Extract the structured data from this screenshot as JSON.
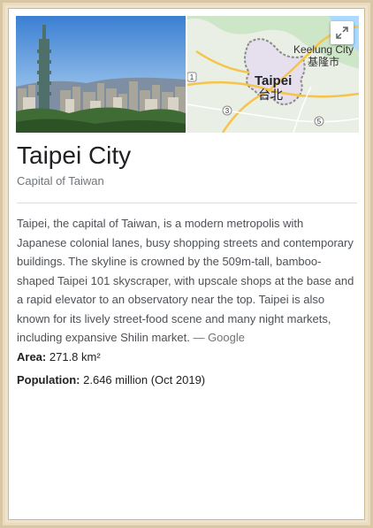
{
  "entity": {
    "title": "Taipei City",
    "subtitle": "Capital of Taiwan"
  },
  "map": {
    "labels": {
      "keelung_en": "Keelung City",
      "keelung_zh": "基隆市",
      "taipei_en": "Taipei",
      "taipei_zh": "台北",
      "road_1": "1",
      "road_3": "3",
      "road_5": "5"
    }
  },
  "description": {
    "text": "Taipei, the capital of Taiwan, is a modern metropolis with Japanese colonial lanes, busy shopping streets and contemporary buildings. The skyline is crowned by the 509m-tall, bamboo-shaped Taipei 101 skyscraper, with upscale shops at the base and a rapid elevator to an observatory near the top. Taipei is also known for its lively street-food scene and many night markets, including expansive Shilin market.",
    "source": "— Google"
  },
  "facts": [
    {
      "label": "Area:",
      "value": "271.8 km²"
    },
    {
      "label": "Population:",
      "value": "2.646 million (Oct 2019)"
    }
  ],
  "colors": {
    "title": "#202124",
    "subtitle": "#70757a",
    "body": "#4d5156",
    "frame": "#efe4cb"
  }
}
